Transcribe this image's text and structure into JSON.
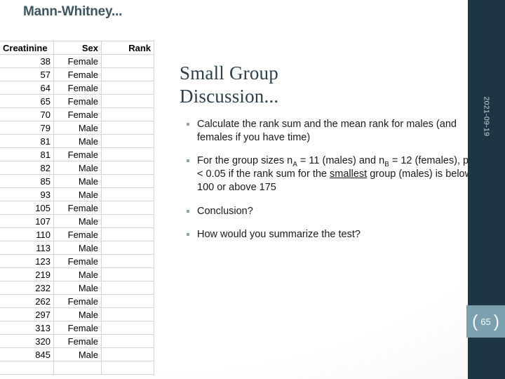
{
  "slide": {
    "title": "Mann-Whitney...",
    "date": "2021-09-19",
    "page_number": "65",
    "bracket_left": "(",
    "bracket_right": ")",
    "accent_dark": "#1e3643",
    "accent_badge": "#7ba0b0",
    "title_color": "#3d5662",
    "heading_color": "#2b3f4c"
  },
  "table": {
    "columns": [
      "Creatinine",
      "Sex",
      "Rank"
    ],
    "rows": [
      {
        "creatinine": "38",
        "sex": "Female",
        "rank": ""
      },
      {
        "creatinine": "57",
        "sex": "Female",
        "rank": ""
      },
      {
        "creatinine": "64",
        "sex": "Female",
        "rank": ""
      },
      {
        "creatinine": "65",
        "sex": "Female",
        "rank": ""
      },
      {
        "creatinine": "70",
        "sex": "Female",
        "rank": ""
      },
      {
        "creatinine": "79",
        "sex": "Male",
        "rank": ""
      },
      {
        "creatinine": "81",
        "sex": "Male",
        "rank": ""
      },
      {
        "creatinine": "81",
        "sex": "Female",
        "rank": ""
      },
      {
        "creatinine": "82",
        "sex": "Male",
        "rank": ""
      },
      {
        "creatinine": "85",
        "sex": "Male",
        "rank": ""
      },
      {
        "creatinine": "93",
        "sex": "Male",
        "rank": ""
      },
      {
        "creatinine": "105",
        "sex": "Female",
        "rank": ""
      },
      {
        "creatinine": "107",
        "sex": "Male",
        "rank": ""
      },
      {
        "creatinine": "110",
        "sex": "Female",
        "rank": ""
      },
      {
        "creatinine": "113",
        "sex": "Male",
        "rank": ""
      },
      {
        "creatinine": "123",
        "sex": "Female",
        "rank": ""
      },
      {
        "creatinine": "219",
        "sex": "Male",
        "rank": ""
      },
      {
        "creatinine": "232",
        "sex": "Male",
        "rank": ""
      },
      {
        "creatinine": "262",
        "sex": "Female",
        "rank": ""
      },
      {
        "creatinine": "297",
        "sex": "Male",
        "rank": ""
      },
      {
        "creatinine": "313",
        "sex": "Female",
        "rank": ""
      },
      {
        "creatinine": "320",
        "sex": "Female",
        "rank": ""
      },
      {
        "creatinine": "845",
        "sex": "Male",
        "rank": ""
      },
      {
        "creatinine": "",
        "sex": "",
        "rank": ""
      }
    ]
  },
  "content": {
    "heading_line1": "Small Group",
    "heading_line2": "Discussion...",
    "bullet1": "Calculate the rank sum and the mean rank for males (and females if you have time)",
    "bullet2": {
      "part1": "For the group sizes n",
      "sub1": "A",
      "part2": " = 11 (males) and n",
      "sub2": "B",
      "part3": " = 12 (females), p < 0.05 if the rank sum for the ",
      "emphasis": "smallest",
      "part4": " group (males) is below 100 or above 175"
    },
    "bullet3": "Conclusion?",
    "bullet4": "How would you summarize the test?"
  }
}
